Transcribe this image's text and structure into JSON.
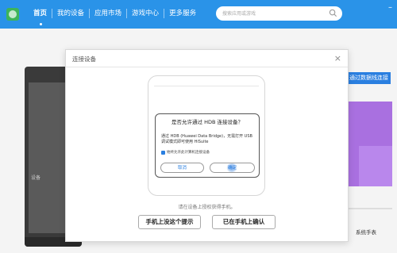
{
  "nav": {
    "items": [
      {
        "label": "首页"
      },
      {
        "label": "我的设备"
      },
      {
        "label": "应用市场"
      },
      {
        "label": "游戏中心"
      },
      {
        "label": "更多服务"
      }
    ]
  },
  "search": {
    "placeholder": "搜索应用或游戏"
  },
  "background": {
    "device_label": "设备",
    "right_link": "通过数据线连接",
    "watermark": "系统手表"
  },
  "dialog": {
    "title": "连接设备",
    "close": "×",
    "prompt": {
      "title": "是否允许通过 HDB 连接设备？",
      "body": "通过 HDB (Huawei Data Bridge)，无需打开 USB 调试模式即可使用 HiSuite",
      "checkbox_label": "始终允许此计算机连接设备",
      "cancel": "取消",
      "ok": "确定"
    },
    "hint": "请在设备上授权获得手机。",
    "buttons": {
      "left": "手机上没这个提示",
      "right": "已在手机上确认"
    }
  },
  "colors": {
    "accent": "#2a93e8",
    "purple": "#a970e0"
  }
}
